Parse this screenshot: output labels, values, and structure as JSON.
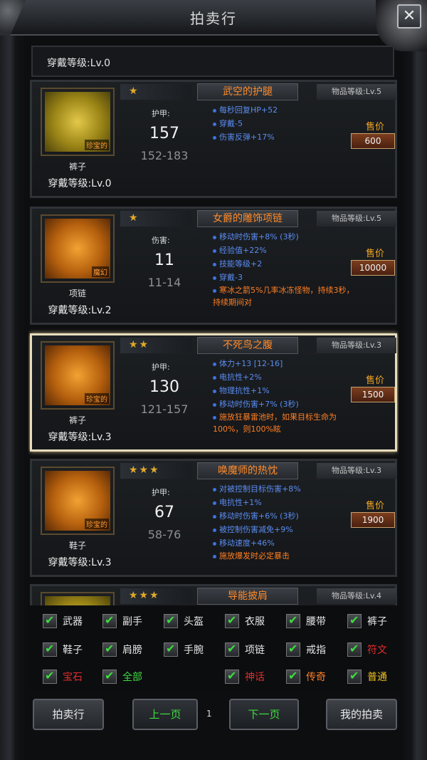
{
  "header": {
    "title": "拍卖行",
    "close_label": "✕"
  },
  "stub": {
    "requirement": "穿戴等级:Lv.0"
  },
  "items": [
    {
      "stars": "★",
      "name": "武空的护腿",
      "level": "物品等级:Lv.5",
      "type": "裤子",
      "requirement": "穿戴等级:Lv.0",
      "tag": "珍宝的",
      "stat_label": "护甲:",
      "stat_value": "157",
      "stat_range": "152-183",
      "affixes": [
        "每秒回复HP+52",
        "穿戴-5",
        "伤害反弹+17%"
      ],
      "extra": "",
      "price_label": "售价",
      "price": "600",
      "icon_color": "yellow"
    },
    {
      "stars": "★",
      "name": "女爵的雕饰项链",
      "level": "物品等级:Lv.5",
      "type": "项链",
      "requirement": "穿戴等级:Lv.2",
      "tag": "魔幻",
      "stat_label": "伤害:",
      "stat_value": "11",
      "stat_range": "11-14",
      "affixes": [
        "移动时伤害+8% (3秒)",
        "经验值+22%",
        "技能等级+2",
        "穿戴-3"
      ],
      "extra": "寒冰之箭5%几率冰冻怪物，持续3秒，持续期间对",
      "price_label": "售价",
      "price": "10000",
      "icon_color": "orange"
    },
    {
      "stars": "★★",
      "name": "不死鸟之腹",
      "level": "物品等级:Lv.3",
      "type": "裤子",
      "requirement": "穿戴等级:Lv.3",
      "tag": "珍宝的",
      "stat_label": "护甲:",
      "stat_value": "130",
      "stat_range": "121-157",
      "affixes": [
        "体力+13 [12-16]",
        "电抗性+2%",
        "物理抗性+1%",
        "移动时伤害+7% (3秒)"
      ],
      "extra": "施放狂暴雷池时，如果目标生命为100%，则100%眩",
      "price_label": "售价",
      "price": "1500",
      "icon_color": "orange"
    },
    {
      "stars": "★★★",
      "name": "唤魔师的热忱",
      "level": "物品等级:Lv.3",
      "type": "鞋子",
      "requirement": "穿戴等级:Lv.3",
      "tag": "珍宝的",
      "stat_label": "护甲:",
      "stat_value": "67",
      "stat_range": "58-76",
      "affixes": [
        "对被控制目标伤害+8%",
        "电抗性+1%",
        "移动时伤害+6% (3秒)",
        "被控制伤害减免+9%",
        "移动速度+46%"
      ],
      "extra": "施放爆发时必定暴击",
      "price_label": "售价",
      "price": "1900",
      "icon_color": "orange"
    },
    {
      "stars": "★★★",
      "name": "导能披肩",
      "level": "物品等级:Lv.4",
      "type": "",
      "requirement": "",
      "tag": "",
      "stat_label": "",
      "stat_value": "",
      "stat_range": "",
      "affixes": [],
      "extra": "",
      "price_label": "",
      "price": "",
      "icon_color": "yellow"
    }
  ],
  "filters": [
    {
      "label": "武器",
      "color": "#e6e6e6"
    },
    {
      "label": "副手",
      "color": "#e6e6e6"
    },
    {
      "label": "头盔",
      "color": "#e6e6e6"
    },
    {
      "label": "衣服",
      "color": "#e6e6e6"
    },
    {
      "label": "腰带",
      "color": "#e6e6e6"
    },
    {
      "label": "裤子",
      "color": "#e6e6e6"
    },
    {
      "label": "鞋子",
      "color": "#e6e6e6"
    },
    {
      "label": "肩膀",
      "color": "#e6e6e6"
    },
    {
      "label": "手腕",
      "color": "#e6e6e6"
    },
    {
      "label": "项链",
      "color": "#e6e6e6"
    },
    {
      "label": "戒指",
      "color": "#e6e6e6"
    },
    {
      "label": "符文",
      "color": "#e02c2c"
    },
    {
      "label": "宝石",
      "color": "#e02c2c"
    },
    {
      "label": "全部",
      "color": "#3ddc3d"
    },
    {
      "label": "神话",
      "color": "#e02c2c"
    },
    {
      "label": "传奇",
      "color": "#ff7f24"
    },
    {
      "label": "普通",
      "color": "#f0c020"
    }
  ],
  "buttons": {
    "auction": "拍卖行",
    "prev": "上一页",
    "page": "1",
    "next": "下一页",
    "my_auction": "我的拍卖"
  }
}
